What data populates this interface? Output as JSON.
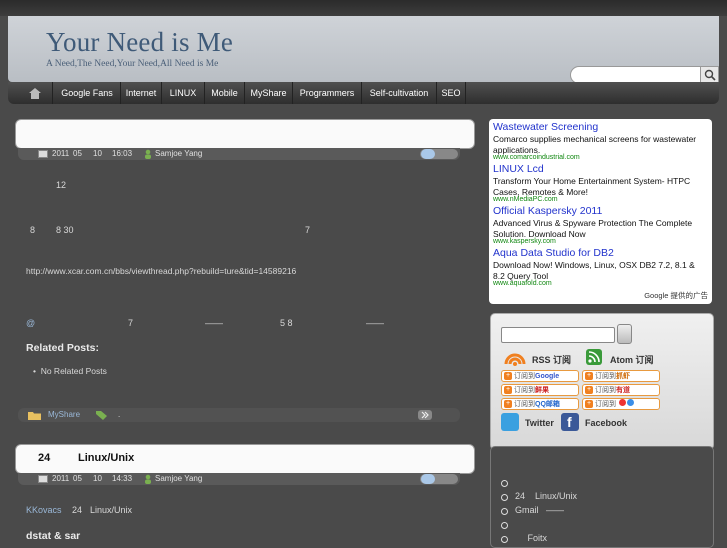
{
  "site": {
    "title": "Your Need is Me",
    "tagline": "A Need,The Need,Your Need,All Need is Me"
  },
  "nav": {
    "items": [
      "Google Fans",
      "Internet",
      "LINUX",
      "Mobile",
      "MyShare",
      "Programmers",
      "Self-cultivation",
      "SEO"
    ]
  },
  "post1": {
    "meta": {
      "date_parts": [
        "2011",
        "05",
        "10"
      ],
      "time": "16:03",
      "author": "Samjoe Yang"
    },
    "body": {
      "line1": "12",
      "line2a": "8",
      "line2b": "8 30",
      "line2c": "7",
      "url": "http://www.xcar.com.cn/bbs/viewthread.php?rebuild=ture&tid=14589216",
      "at": "@",
      "n7": "7",
      "dash1": "——",
      "n58": "5 8",
      "dash2": "——"
    },
    "related_title": "Related Posts:",
    "related_empty": "No Related Posts",
    "footer": {
      "category": "MyShare",
      "tags": "."
    }
  },
  "post2": {
    "title_num": "24",
    "title": "Linux/Unix",
    "meta": {
      "date_parts": [
        "2011",
        "05",
        "10"
      ],
      "time": "14:33",
      "author": "Samjoe Yang"
    },
    "link": "KKovacs",
    "intro_num": "24",
    "intro": "Linux/Unix",
    "heading": "dstat & sar"
  },
  "ads": [
    {
      "title": "Wastewater Screening",
      "desc": "Comarco supplies mechanical screens for wastewater applications.",
      "url": "www.comarcoindustrial.com"
    },
    {
      "title": "LINUX Lcd",
      "desc": "Transform Your Home Entertainment System- HTPC Cases, Remotes & More!",
      "url": "www.nMediaPC.com"
    },
    {
      "title": "Official Kaspersky 2011",
      "desc": "Advanced Virus & Spyware Protection The Complete Solution. Download Now",
      "url": "www.kaspersky.com"
    },
    {
      "title": "Aqua Data Studio for DB2",
      "desc": "Download Now! Windows, Linux, OSX DB2 7.2, 8.1 & 8.2 Query Tool",
      "url": "www.aquafold.com"
    }
  ],
  "ads_footer": "Google 提供的广告",
  "feeds": {
    "rss": "RSS 订阅",
    "atom": "Atom 订阅",
    "subscribe": [
      {
        "prefix": "订阅到",
        "name": "Google",
        "color": "#3355cc"
      },
      {
        "prefix": "订阅到",
        "name": "抓虾",
        "color": "#cc6600"
      },
      {
        "prefix": "订阅到",
        "name": "鲜果",
        "color": "#cc2222"
      },
      {
        "prefix": "订阅到",
        "name": "有道",
        "color": "#cc2222"
      },
      {
        "prefix": "订阅到",
        "name": "QQ邮箱",
        "color": "#2266cc"
      },
      {
        "prefix": "订阅到",
        "name": "",
        "color": "#2266cc"
      }
    ],
    "twitter": "Twitter",
    "facebook": "Facebook"
  },
  "recent": {
    "items": [
      "",
      "24    Linux/Unix",
      "Gmail   ——",
      "",
      "     Foitx"
    ]
  },
  "colors": {
    "background": "#4a4a4a",
    "header_title": "#3f5a78",
    "ad_link": "#2233cc",
    "ad_url": "#118811"
  }
}
